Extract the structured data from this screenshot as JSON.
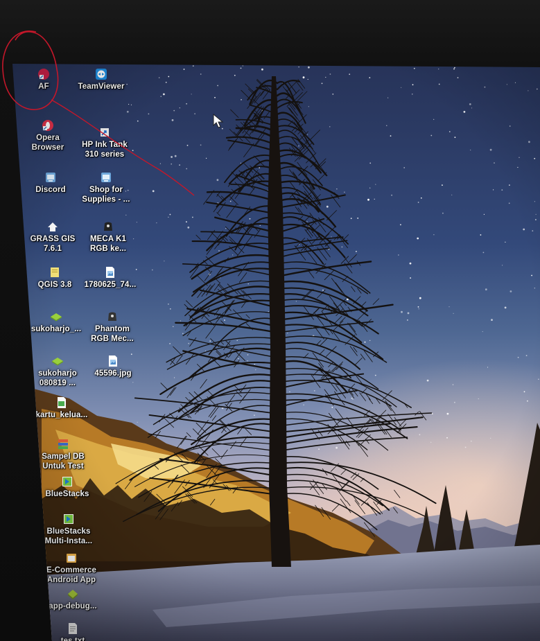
{
  "desktop": {
    "icons": [
      {
        "id": "af",
        "label": "AF",
        "icon": "file-shortcut-icon",
        "color": "#d0234a"
      },
      {
        "id": "teamviewer",
        "label": "TeamViewer",
        "icon": "teamviewer-icon",
        "color": "#1f8ee0"
      },
      {
        "id": "opera",
        "label": "Opera\nBrowser",
        "icon": "opera-icon",
        "color": "#e0324a"
      },
      {
        "id": "hp-ink-tank",
        "label": "HP Ink Tank\n310 series",
        "icon": "printer-icon",
        "color": "#e8e8e8"
      },
      {
        "id": "discord",
        "label": "Discord",
        "icon": "discord-icon",
        "color": "#6fa8dc"
      },
      {
        "id": "shop-supplies",
        "label": "Shop for\nSupplies - ...",
        "icon": "shop-icon",
        "color": "#6fa8dc"
      },
      {
        "id": "grass-gis",
        "label": "GRASS GIS\n7.6.1",
        "icon": "grass-icon",
        "color": "#ffffff"
      },
      {
        "id": "meca-k1",
        "label": "MECA K1\nRGB ke...",
        "icon": "keyboard-icon",
        "color": "#222222"
      },
      {
        "id": "qgis",
        "label": "QGIS 3.8",
        "icon": "qgis-icon",
        "color": "#f3e27a"
      },
      {
        "id": "file-1780625",
        "label": "1780625_74...",
        "icon": "image-file-icon",
        "color": "#9ec9ee"
      },
      {
        "id": "sukoharjo-1",
        "label": "sukoharjo_...",
        "icon": "gis-layer-icon",
        "color": "#9bd23c"
      },
      {
        "id": "phantom",
        "label": "Phantom\nRGB Mec...",
        "icon": "keyboard-icon",
        "color": "#333333"
      },
      {
        "id": "sukoharjo-2",
        "label": "sukoharjo\n080819 ...",
        "icon": "gis-layer-icon",
        "color": "#9bd23c"
      },
      {
        "id": "jpg-45596",
        "label": "45596.jpg",
        "icon": "image-file-icon",
        "color": "#9ec9ee"
      },
      {
        "id": "kartu",
        "label": "kartu_kelua...",
        "icon": "document-icon",
        "color": "#4caf50"
      },
      {
        "id": "sampel-db",
        "label": "Sampel DB\nUntuk Test",
        "icon": "database-icon",
        "color": "#3a6bc8"
      },
      {
        "id": "bluestacks",
        "label": "BlueStacks",
        "icon": "bluestacks-icon",
        "color": "#7ac943"
      },
      {
        "id": "bluestacks-multi",
        "label": "BlueStacks\nMulti-Insta...",
        "icon": "bluestacks-icon",
        "color": "#7ac943"
      },
      {
        "id": "ecommerce",
        "label": "E-Commerce\nAndroid App",
        "icon": "folder-icon",
        "color": "#f0b44a"
      },
      {
        "id": "app-debug",
        "label": "app-debug...",
        "icon": "apk-icon",
        "color": "#a4c639"
      },
      {
        "id": "tes-txt",
        "label": "tes.txt",
        "icon": "text-file-icon",
        "color": "#e6e6e6"
      }
    ]
  },
  "annotation": {
    "color": "#c4172a"
  }
}
